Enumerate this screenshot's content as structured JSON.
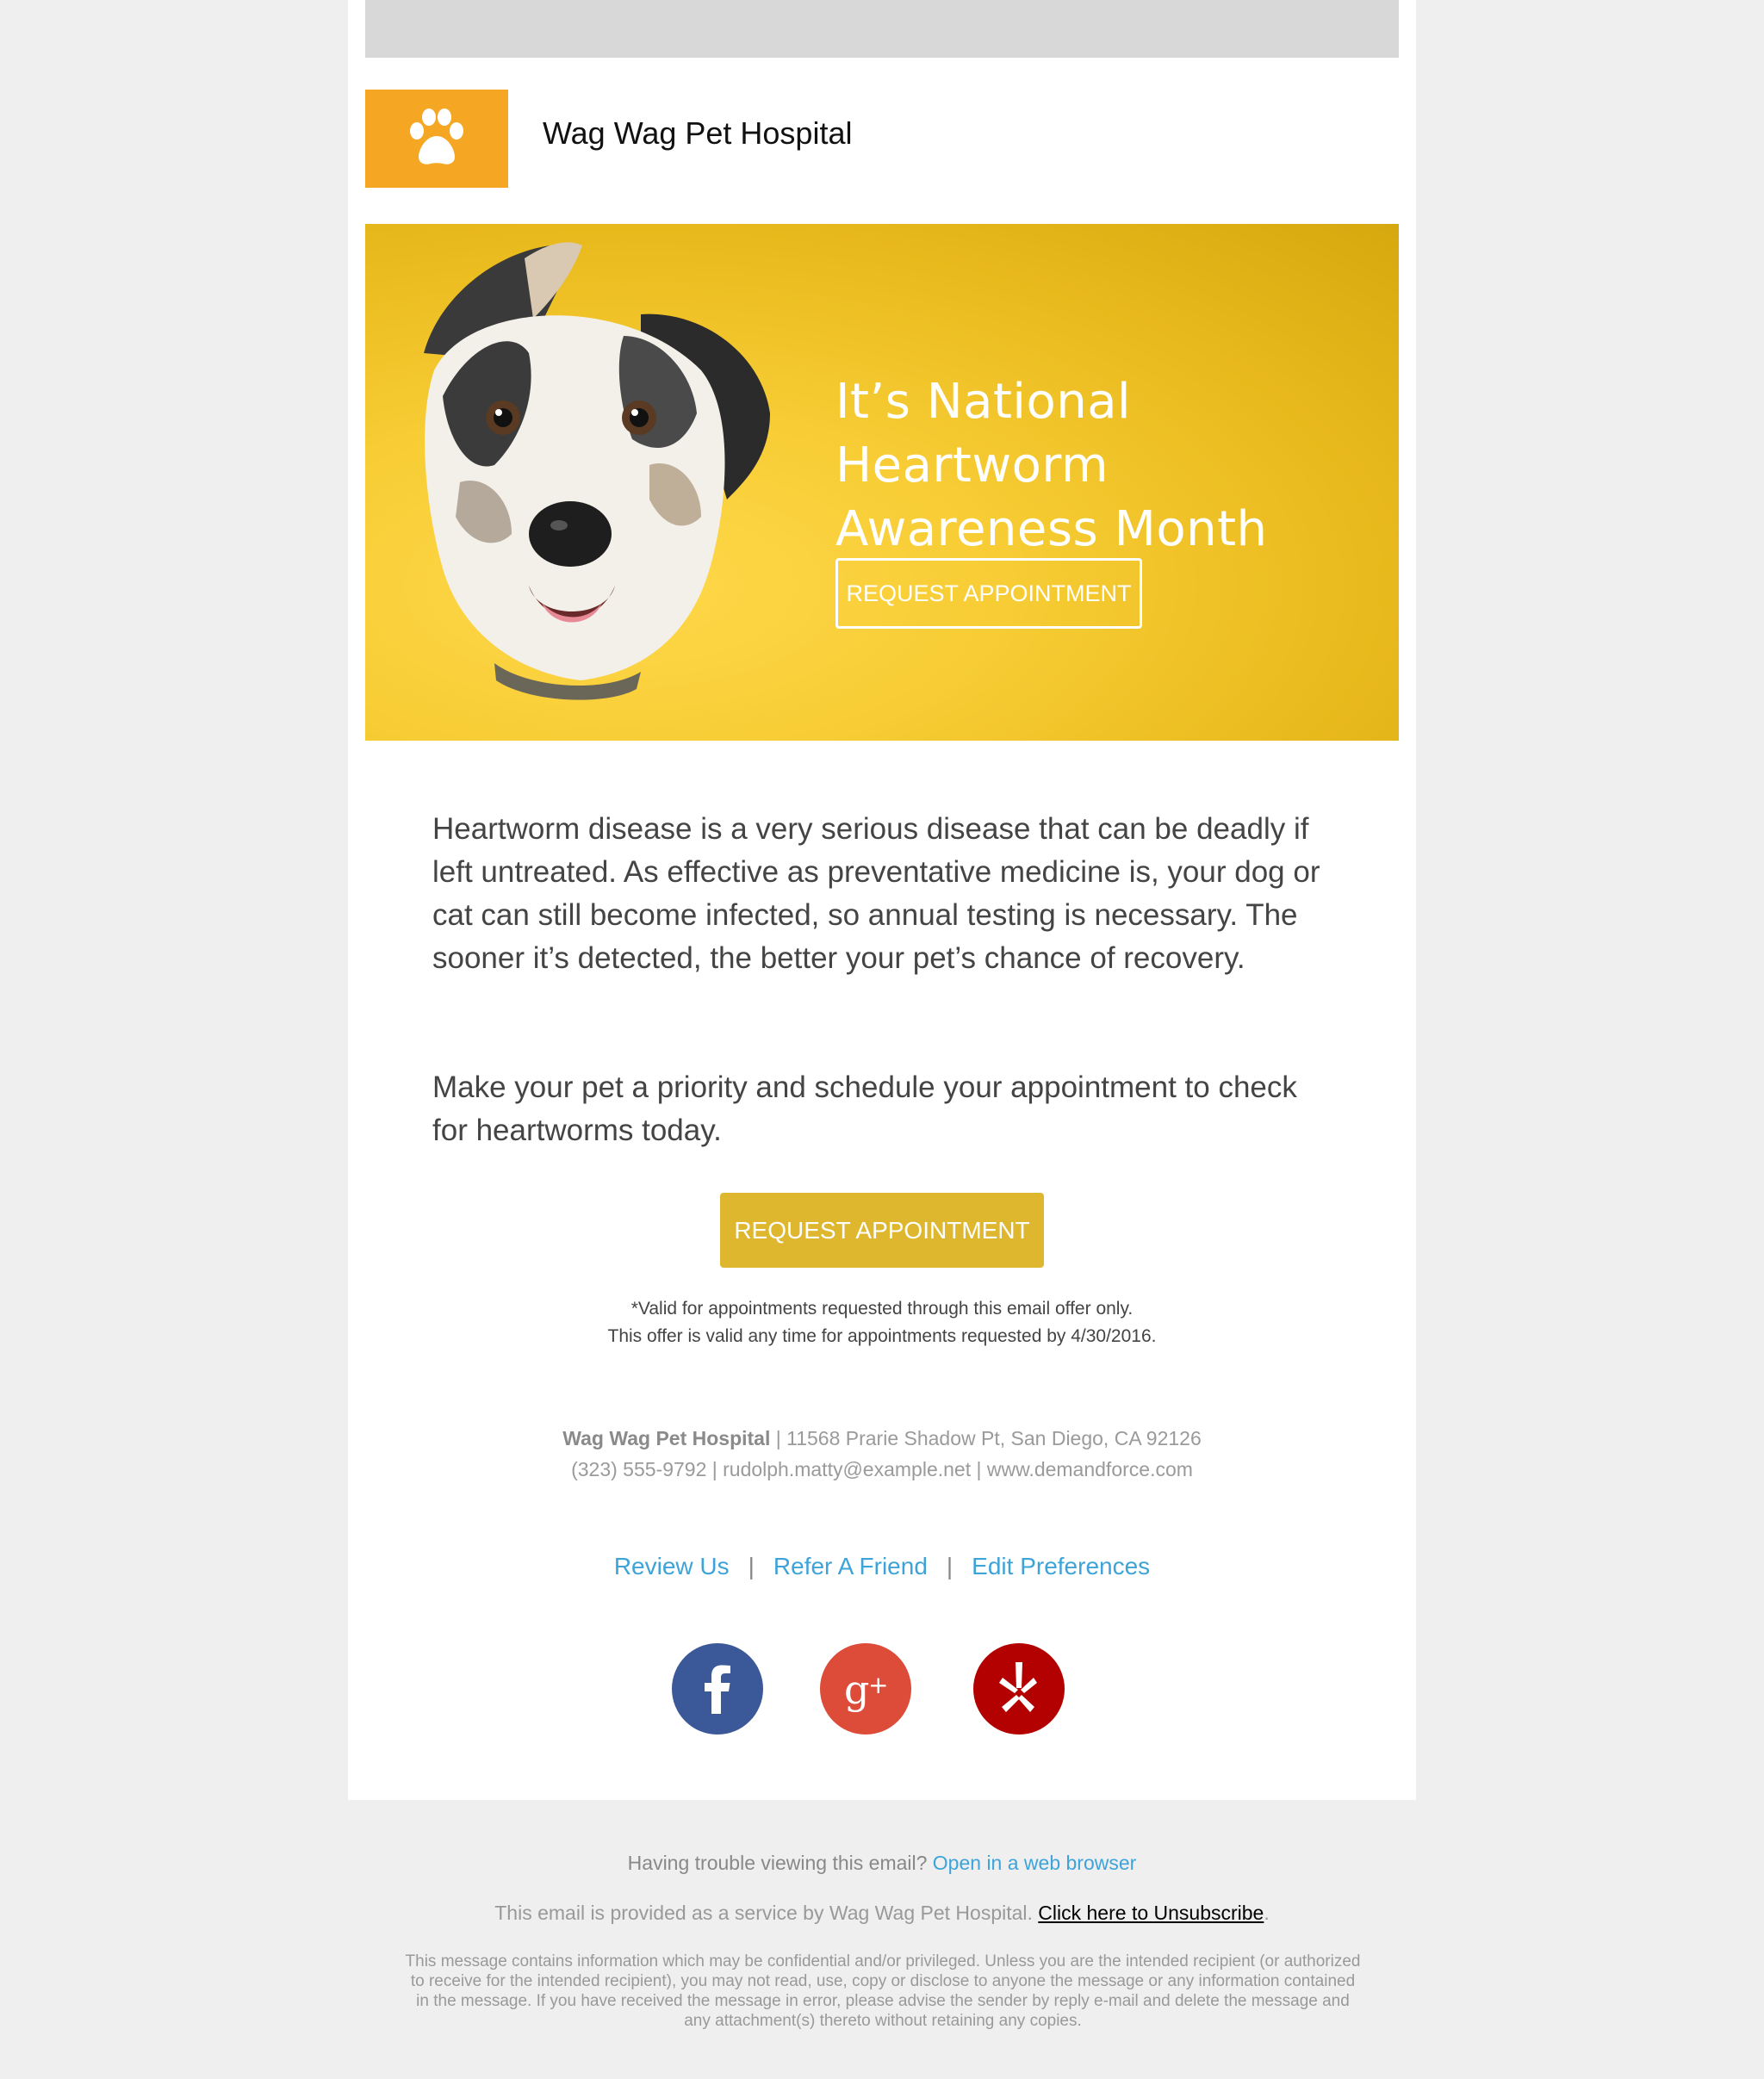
{
  "header": {
    "brand_name": "Wag Wag Pet Hospital",
    "logo_color": "#f5a623"
  },
  "hero": {
    "title": "It’s National Heartworm Awareness Month",
    "button_label": "REQUEST APPOINTMENT",
    "background_color": "#f2c52c"
  },
  "body": {
    "paragraph_1": "Heartworm disease is a very serious disease that can be deadly if left untreated. As effective as preventative medicine is, your dog or cat can still become infected, so annual testing is necessary. The sooner it’s detected, the better your pet’s chance of recovery.",
    "paragraph_2": "Make your pet a priority and schedule your appointment to check for heartworms today.",
    "cta_label": "REQUEST APPOINTMENT",
    "cta_color": "#deb72f",
    "disclaimer_1": "*Valid for appointments requested through this email offer only.",
    "disclaimer_2": "This offer is valid any time for appointments requested by 4/30/2016."
  },
  "contact": {
    "name": "Wag Wag Pet Hospital",
    "address": " | 11568 Prarie Shadow Pt, San Diego, CA 92126",
    "line_2": "(323) 555-9792 | rudolph.matty@example.net | www.demandforce.com"
  },
  "links": {
    "review": "Review Us",
    "refer": "Refer A Friend",
    "preferences": "Edit Preferences",
    "separator": "|"
  },
  "social": {
    "facebook_color": "#3b5998",
    "google_color": "#dd4b39",
    "yelp_color": "#b30000"
  },
  "footer": {
    "trouble_text": "Having trouble viewing this email? ",
    "trouble_link": "Open in a web browser",
    "service_text": "This email is provided as a service by Wag Wag Pet Hospital. ",
    "unsubscribe_link": "Click here to Unsubscribe",
    "service_end": ".",
    "legal": "This message contains information which may be confidential and/or privileged. Unless you are the intended recipient (or authorized to receive for the intended recipient), you may not read, use, copy or disclose to anyone the message or any information contained in the message. If you have received the message in error, please advise the sender by reply e-mail and delete the message and any attachment(s) thereto without retaining any copies."
  }
}
